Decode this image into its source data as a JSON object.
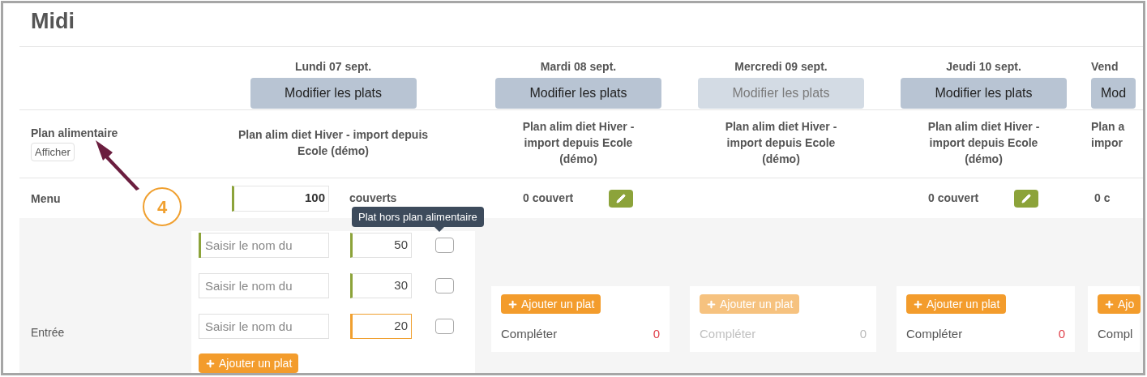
{
  "title": "Midi",
  "row_labels": {
    "plan": "Plan alimentaire",
    "show_button": "Afficher",
    "menu": "Menu",
    "entree": "Entrée"
  },
  "days": [
    {
      "date": "Lundi 07 sept.",
      "edit_button": {
        "label": "Modifier les plats",
        "disabled": false
      },
      "plan": "Plan alim diet Hiver - import depuis Ecole (démo)",
      "menu": {
        "kind": "input",
        "value": "100",
        "unit": "couverts",
        "color": "#8ca33a"
      },
      "entree": {
        "kind": "dishes",
        "dishes": [
          {
            "name_field": {
              "placeholder": "Saisir le nom du",
              "color": "#8ca33a"
            },
            "quantity_field": {
              "value": "50",
              "color": "#8ca33a",
              "focused": false
            },
            "checked": false
          },
          {
            "name_field": {
              "placeholder": "Saisir le nom du"
            },
            "quantity_field": {
              "value": "30",
              "color": "#8ca33a",
              "focused": false
            },
            "checked": false
          },
          {
            "name_field": {
              "placeholder": "Saisir le nom du"
            },
            "quantity_field": {
              "value": "20",
              "color": "#f0a030",
              "focused": true
            },
            "checked": false
          }
        ],
        "add_button": "Ajouter un plat"
      }
    },
    {
      "date": "Mardi 08 sept.",
      "edit_button": {
        "label": "Modifier les plats",
        "disabled": false
      },
      "plan": "Plan alim diet Hiver - import depuis Ecole (démo)",
      "menu": {
        "kind": "summary_edit",
        "text": "0 couvert"
      },
      "entree": {
        "kind": "summary",
        "add_button": "Ajouter un plat",
        "label": "Compléter",
        "count": "0",
        "disabled": false
      }
    },
    {
      "date": "Mercredi 09 sept.",
      "edit_button": {
        "label": "Modifier les plats",
        "disabled": true
      },
      "plan": "Plan alim diet Hiver - import depuis Ecole (démo)",
      "entree": {
        "kind": "summary",
        "add_button": "Ajouter un plat",
        "label": "Compléter",
        "count": "0",
        "disabled": true
      }
    },
    {
      "date": "Jeudi 10 sept.",
      "edit_button": {
        "label": "Modifier les plats",
        "disabled": false
      },
      "plan": "Plan alim diet Hiver - import depuis Ecole (démo)",
      "menu": {
        "kind": "summary_edit",
        "text": "0 couvert"
      },
      "entree": {
        "kind": "summary",
        "add_button": "Ajouter un plat",
        "label": "Compléter",
        "count": "0",
        "disabled": false
      }
    },
    {
      "date": "Vend",
      "edit_button": {
        "label": "Mod",
        "disabled": false
      },
      "plan": "Plan a impor",
      "menu": {
        "kind": "summary",
        "text": "0 c"
      },
      "entree": {
        "kind": "summary",
        "add_button": "Ajo",
        "label": "Compl",
        "disabled": false
      }
    }
  ],
  "tooltip": "Plat hors plan alimentaire",
  "annotation": {
    "number": "4"
  }
}
